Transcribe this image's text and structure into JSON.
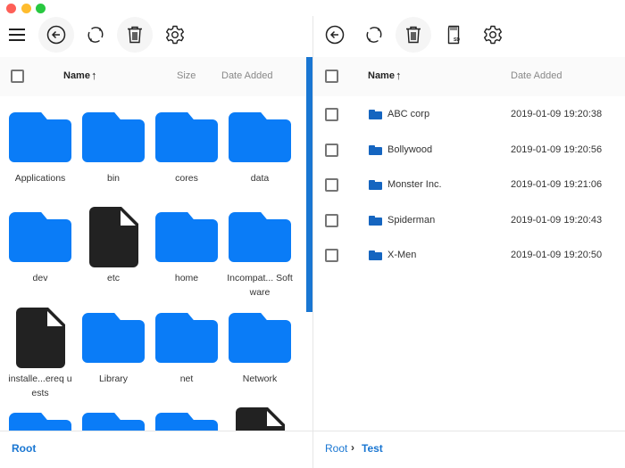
{
  "window": {
    "controls": [
      "close",
      "minimize",
      "maximize"
    ]
  },
  "left_pane": {
    "toolbar": {
      "menu_icon": "hamburger-menu-icon",
      "back_icon": "arrow-left-circle-icon",
      "refresh_icon": "refresh-icon",
      "trash_icon": "trash-icon",
      "settings_icon": "gear-icon"
    },
    "header": {
      "name": "Name",
      "sort_arrow": "↑",
      "size": "Size",
      "date_added": "Date Added"
    },
    "items": [
      {
        "name": "Applications",
        "type": "folder"
      },
      {
        "name": "bin",
        "type": "folder"
      },
      {
        "name": "cores",
        "type": "folder"
      },
      {
        "name": "data",
        "type": "folder"
      },
      {
        "name": "dev",
        "type": "folder"
      },
      {
        "name": "etc",
        "type": "file"
      },
      {
        "name": "home",
        "type": "folder"
      },
      {
        "name": "Incompat... Software",
        "type": "folder"
      },
      {
        "name": "installe...ereq uests",
        "type": "file"
      },
      {
        "name": "Library",
        "type": "folder"
      },
      {
        "name": "net",
        "type": "folder"
      },
      {
        "name": "Network",
        "type": "folder"
      },
      {
        "name": "",
        "type": "folder"
      },
      {
        "name": "",
        "type": "folder"
      },
      {
        "name": "",
        "type": "folder"
      },
      {
        "name": "",
        "type": "file"
      }
    ],
    "breadcrumb": [
      "Root"
    ]
  },
  "right_pane": {
    "toolbar": {
      "back_icon": "arrow-left-circle-icon",
      "refresh_icon": "refresh-icon",
      "trash_icon": "trash-icon",
      "sd_card_icon": "sd-card-icon",
      "sd_label": "SD",
      "settings_icon": "gear-icon"
    },
    "header": {
      "name": "Name",
      "sort_arrow": "↑",
      "date_added": "Date Added"
    },
    "rows": [
      {
        "name": "ABC corp",
        "date": "2019-01-09 19:20:38"
      },
      {
        "name": "Bollywood",
        "date": "2019-01-09 19:20:56"
      },
      {
        "name": "Monster Inc.",
        "date": "2019-01-09 19:21:06"
      },
      {
        "name": "Spiderman",
        "date": "2019-01-09 19:20:43"
      },
      {
        "name": "X-Men",
        "date": "2019-01-09 19:20:50"
      }
    ],
    "breadcrumb": [
      "Root",
      "Test"
    ],
    "breadcrumb_sep": "›"
  },
  "colors": {
    "accent": "#1976d2",
    "folder": "#0a7cf7",
    "file": "#222222"
  }
}
